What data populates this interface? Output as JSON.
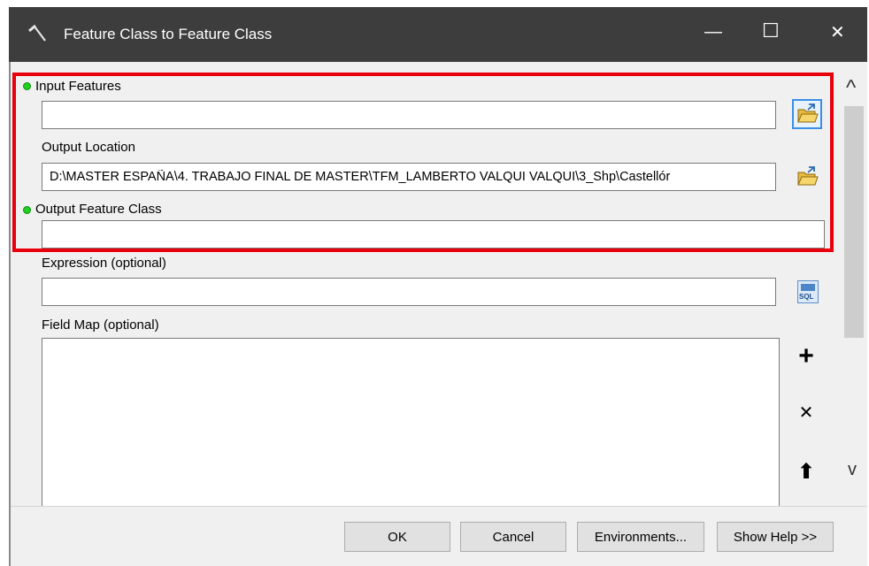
{
  "window": {
    "title": "Feature Class to Feature Class",
    "controls": {
      "minimize": "—",
      "maximize": "☐",
      "close": "✕"
    }
  },
  "form": {
    "input_features": {
      "label": "Input Features",
      "value": "",
      "required": true
    },
    "output_location": {
      "label": "Output Location",
      "value": "D:\\MASTER ESPAÑA\\4. TRABAJO FINAL DE MASTER\\TFM_LAMBERTO VALQUI VALQUI\\3_Shp\\Castellór"
    },
    "output_feature_class": {
      "label": "Output Feature Class",
      "value": "",
      "required": true
    },
    "expression": {
      "label": "Expression (optional)",
      "value": "",
      "sql_icon_text": "SQL"
    },
    "field_map": {
      "label": "Field Map (optional)"
    }
  },
  "side_buttons": {
    "add": "+",
    "remove": "✕",
    "move_up": "⬆"
  },
  "scroll": {
    "up": "^",
    "down": "v"
  },
  "footer": {
    "ok": "OK",
    "cancel": "Cancel",
    "environments": "Environments...",
    "show_help": "Show Help >>"
  },
  "colors": {
    "highlight": "#e8000b",
    "required_dot": "#1fd21f",
    "titlebar": "#3d3d3d",
    "focus": "#3a8ee6"
  }
}
